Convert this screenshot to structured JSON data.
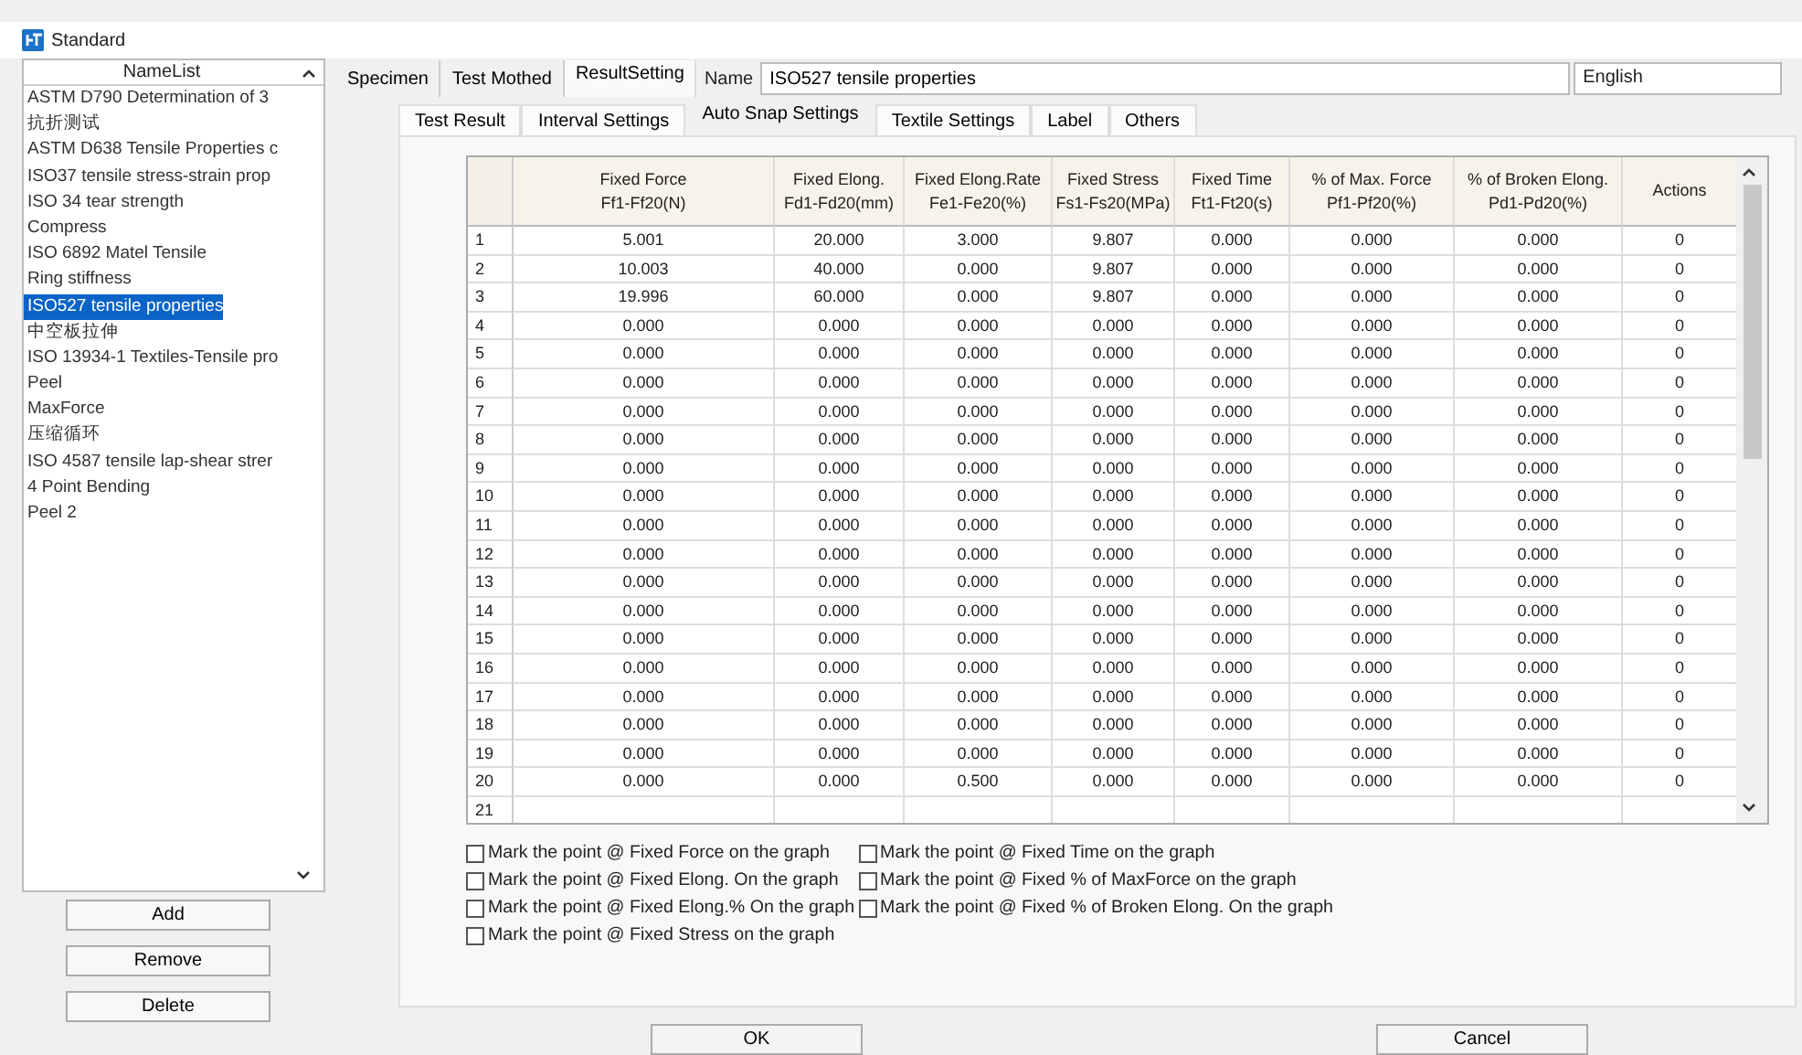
{
  "window": {
    "title": "Standard"
  },
  "name_list": {
    "header": "NameList",
    "items": [
      {
        "label": "ASTM D790 Determination of 3",
        "selected": false
      },
      {
        "label": "抗折测试",
        "selected": false
      },
      {
        "label": "ASTM D638 Tensile Properties c",
        "selected": false
      },
      {
        "label": "ISO37 tensile stress-strain prop",
        "selected": false
      },
      {
        "label": "ISO 34 tear strength",
        "selected": false
      },
      {
        "label": "Compress",
        "selected": false
      },
      {
        "label": "ISO 6892  Matel Tensile",
        "selected": false
      },
      {
        "label": "Ring stiffness",
        "selected": false
      },
      {
        "label": "ISO527 tensile properties",
        "selected": true
      },
      {
        "label": "中空板拉伸",
        "selected": false
      },
      {
        "label": "ISO 13934-1 Textiles-Tensile pro",
        "selected": false
      },
      {
        "label": "Peel",
        "selected": false
      },
      {
        "label": "MaxForce",
        "selected": false
      },
      {
        "label": "压缩循环",
        "selected": false
      },
      {
        "label": "ISO 4587 tensile lap-shear strer",
        "selected": false
      },
      {
        "label": "4 Point Bending",
        "selected": false
      },
      {
        "label": "Peel 2",
        "selected": false
      }
    ]
  },
  "side_buttons": [
    "Add",
    "Remove",
    "Delete"
  ],
  "top_tabs": [
    {
      "label": "Specimen",
      "selected": false
    },
    {
      "label": "Test Mothed",
      "selected": false
    },
    {
      "label": "ResultSetting",
      "selected": true
    }
  ],
  "name_field": {
    "label": "Name",
    "value": "ISO527 tensile properties"
  },
  "language": {
    "value": "English"
  },
  "sub_tabs": [
    {
      "label": "Test Result",
      "selected": false
    },
    {
      "label": "Interval Settings",
      "selected": false
    },
    {
      "label": "Auto Snap Settings",
      "selected": true
    },
    {
      "label": "Textile Settings",
      "selected": false
    },
    {
      "label": "Label",
      "selected": false
    },
    {
      "label": "Others",
      "selected": false
    }
  ],
  "table": {
    "columns": [
      [
        "Fixed Force",
        "Ff1-Ff20(N)"
      ],
      [
        "Fixed Elong.",
        "Fd1-Fd20(mm)"
      ],
      [
        "Fixed Elong.Rate",
        "Fe1-Fe20(%)"
      ],
      [
        "Fixed Stress",
        "Fs1-Fs20(MPa)"
      ],
      [
        "Fixed Time",
        "Ft1-Ft20(s)"
      ],
      [
        "% of Max. Force",
        "Pf1-Pf20(%)"
      ],
      [
        "% of Broken Elong.",
        "Pd1-Pd20(%)"
      ],
      [
        "Actions"
      ]
    ],
    "rows": [
      {
        "number": "1",
        "cells": [
          "5.001",
          "20.000",
          "3.000",
          "9.807",
          "0.000",
          "0.000",
          "0.000",
          "0"
        ]
      },
      {
        "number": "2",
        "cells": [
          "10.003",
          "40.000",
          "0.000",
          "9.807",
          "0.000",
          "0.000",
          "0.000",
          "0"
        ]
      },
      {
        "number": "3",
        "cells": [
          "19.996",
          "60.000",
          "0.000",
          "9.807",
          "0.000",
          "0.000",
          "0.000",
          "0"
        ]
      },
      {
        "number": "4",
        "cells": [
          "0.000",
          "0.000",
          "0.000",
          "0.000",
          "0.000",
          "0.000",
          "0.000",
          "0"
        ]
      },
      {
        "number": "5",
        "cells": [
          "0.000",
          "0.000",
          "0.000",
          "0.000",
          "0.000",
          "0.000",
          "0.000",
          "0"
        ]
      },
      {
        "number": "6",
        "cells": [
          "0.000",
          "0.000",
          "0.000",
          "0.000",
          "0.000",
          "0.000",
          "0.000",
          "0"
        ]
      },
      {
        "number": "7",
        "cells": [
          "0.000",
          "0.000",
          "0.000",
          "0.000",
          "0.000",
          "0.000",
          "0.000",
          "0"
        ]
      },
      {
        "number": "8",
        "cells": [
          "0.000",
          "0.000",
          "0.000",
          "0.000",
          "0.000",
          "0.000",
          "0.000",
          "0"
        ]
      },
      {
        "number": "9",
        "cells": [
          "0.000",
          "0.000",
          "0.000",
          "0.000",
          "0.000",
          "0.000",
          "0.000",
          "0"
        ]
      },
      {
        "number": "10",
        "cells": [
          "0.000",
          "0.000",
          "0.000",
          "0.000",
          "0.000",
          "0.000",
          "0.000",
          "0"
        ]
      },
      {
        "number": "11",
        "cells": [
          "0.000",
          "0.000",
          "0.000",
          "0.000",
          "0.000",
          "0.000",
          "0.000",
          "0"
        ]
      },
      {
        "number": "12",
        "cells": [
          "0.000",
          "0.000",
          "0.000",
          "0.000",
          "0.000",
          "0.000",
          "0.000",
          "0"
        ]
      },
      {
        "number": "13",
        "cells": [
          "0.000",
          "0.000",
          "0.000",
          "0.000",
          "0.000",
          "0.000",
          "0.000",
          "0"
        ]
      },
      {
        "number": "14",
        "cells": [
          "0.000",
          "0.000",
          "0.000",
          "0.000",
          "0.000",
          "0.000",
          "0.000",
          "0"
        ]
      },
      {
        "number": "15",
        "cells": [
          "0.000",
          "0.000",
          "0.000",
          "0.000",
          "0.000",
          "0.000",
          "0.000",
          "0"
        ]
      },
      {
        "number": "16",
        "cells": [
          "0.000",
          "0.000",
          "0.000",
          "0.000",
          "0.000",
          "0.000",
          "0.000",
          "0"
        ]
      },
      {
        "number": "17",
        "cells": [
          "0.000",
          "0.000",
          "0.000",
          "0.000",
          "0.000",
          "0.000",
          "0.000",
          "0"
        ]
      },
      {
        "number": "18",
        "cells": [
          "0.000",
          "0.000",
          "0.000",
          "0.000",
          "0.000",
          "0.000",
          "0.000",
          "0"
        ]
      },
      {
        "number": "19",
        "cells": [
          "0.000",
          "0.000",
          "0.000",
          "0.000",
          "0.000",
          "0.000",
          "0.000",
          "0"
        ]
      },
      {
        "number": "20",
        "cells": [
          "0.000",
          "0.000",
          "0.500",
          "0.000",
          "0.000",
          "0.000",
          "0.000",
          "0"
        ]
      },
      {
        "number": "21"
      }
    ]
  },
  "checkbox_columns": [
    [
      {
        "label": "Mark the point @ Fixed Force on the graph",
        "checked": false
      },
      {
        "label": "Mark the point @ Fixed Elong. On the graph",
        "checked": false
      },
      {
        "label": "Mark the point @ Fixed Elong.% On the graph",
        "checked": false
      },
      {
        "label": "Mark the point @ Fixed Stress on the graph",
        "checked": false
      }
    ],
    [
      {
        "label": "Mark the point @ Fixed Time on the graph",
        "checked": false
      },
      {
        "label": "Mark the point @ Fixed % of MaxForce on the graph",
        "checked": false
      },
      {
        "label": "Mark the point @ Fixed % of Broken Elong. On the graph",
        "checked": false
      }
    ]
  ],
  "bottom_buttons": [
    "OK",
    "Cancel"
  ]
}
